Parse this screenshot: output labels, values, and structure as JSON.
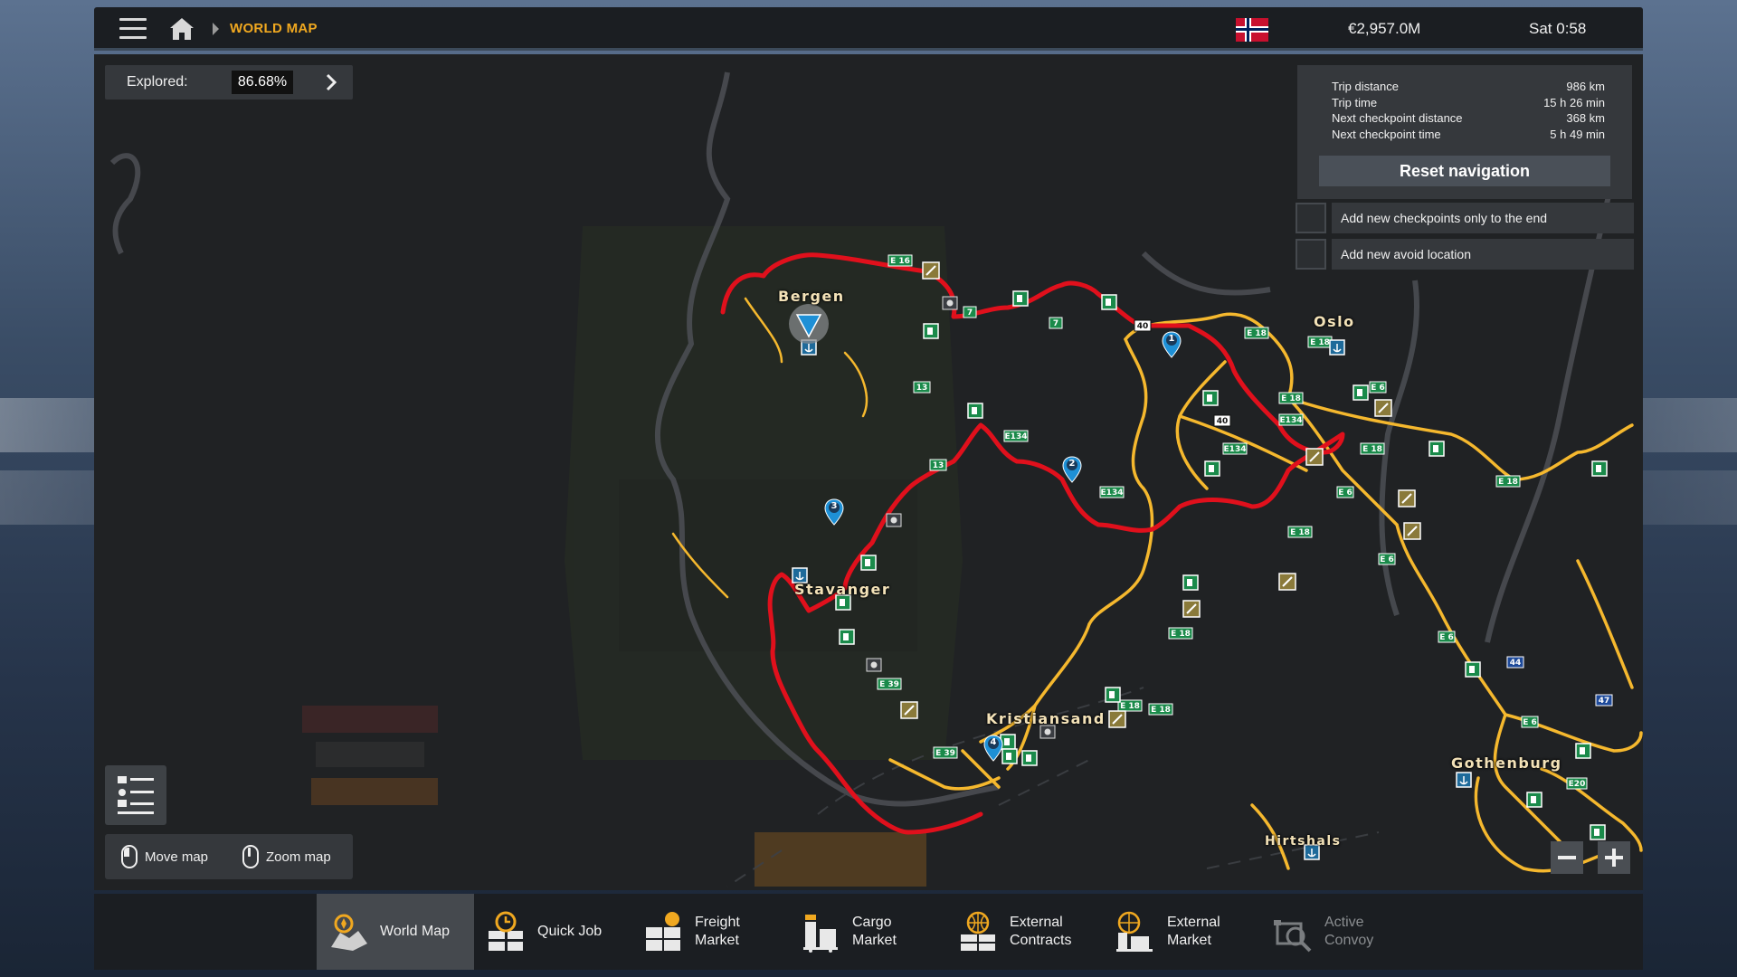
{
  "header": {
    "breadcrumb": "WORLD MAP",
    "money": "€2,957.0M",
    "time": "Sat 0:58"
  },
  "explored": {
    "label": "Explored:",
    "value": "86.68%"
  },
  "trip": {
    "rows": [
      {
        "label": "Trip distance",
        "value": "986 km"
      },
      {
        "label": "Trip time",
        "value": "15 h 26 min"
      },
      {
        "label": "Next checkpoint distance",
        "value": "368 km"
      },
      {
        "label": "Next checkpoint time",
        "value": "5 h 49 min"
      }
    ],
    "reset_label": "Reset navigation"
  },
  "options": [
    {
      "label": "Add new checkpoints only to the end",
      "checked": false
    },
    {
      "label": "Add new avoid location",
      "checked": false
    }
  ],
  "hints": {
    "move": "Move map",
    "zoom": "Zoom map"
  },
  "cities": {
    "bergen": "Bergen",
    "oslo": "Oslo",
    "stavanger": "Stavanger",
    "kristiansand": "Kristiansand",
    "gothenburg": "Gothenburg",
    "hirtshals": "Hirtshals"
  },
  "road_labels": [
    "E 16",
    "7",
    "40",
    "13",
    "E134",
    "E18",
    "E6",
    "E39",
    "44",
    "47",
    "E20"
  ],
  "checkpoints": [
    "1",
    "2",
    "3",
    "4"
  ],
  "colors": {
    "accent": "#f0a820",
    "route": "#e0101c",
    "road": "#f5b82e",
    "marker": "#1e90d6"
  },
  "tabs": [
    {
      "line1": "World Map",
      "line2": "",
      "active": true,
      "enabled": true
    },
    {
      "line1": "Quick Job",
      "line2": "",
      "active": false,
      "enabled": true
    },
    {
      "line1": "Freight",
      "line2": "Market",
      "active": false,
      "enabled": true
    },
    {
      "line1": "Cargo",
      "line2": "Market",
      "active": false,
      "enabled": true
    },
    {
      "line1": "External",
      "line2": "Contracts",
      "active": false,
      "enabled": true
    },
    {
      "line1": "External",
      "line2": "Market",
      "active": false,
      "enabled": true
    },
    {
      "line1": "Active",
      "line2": "Convoy",
      "active": false,
      "enabled": false
    }
  ]
}
